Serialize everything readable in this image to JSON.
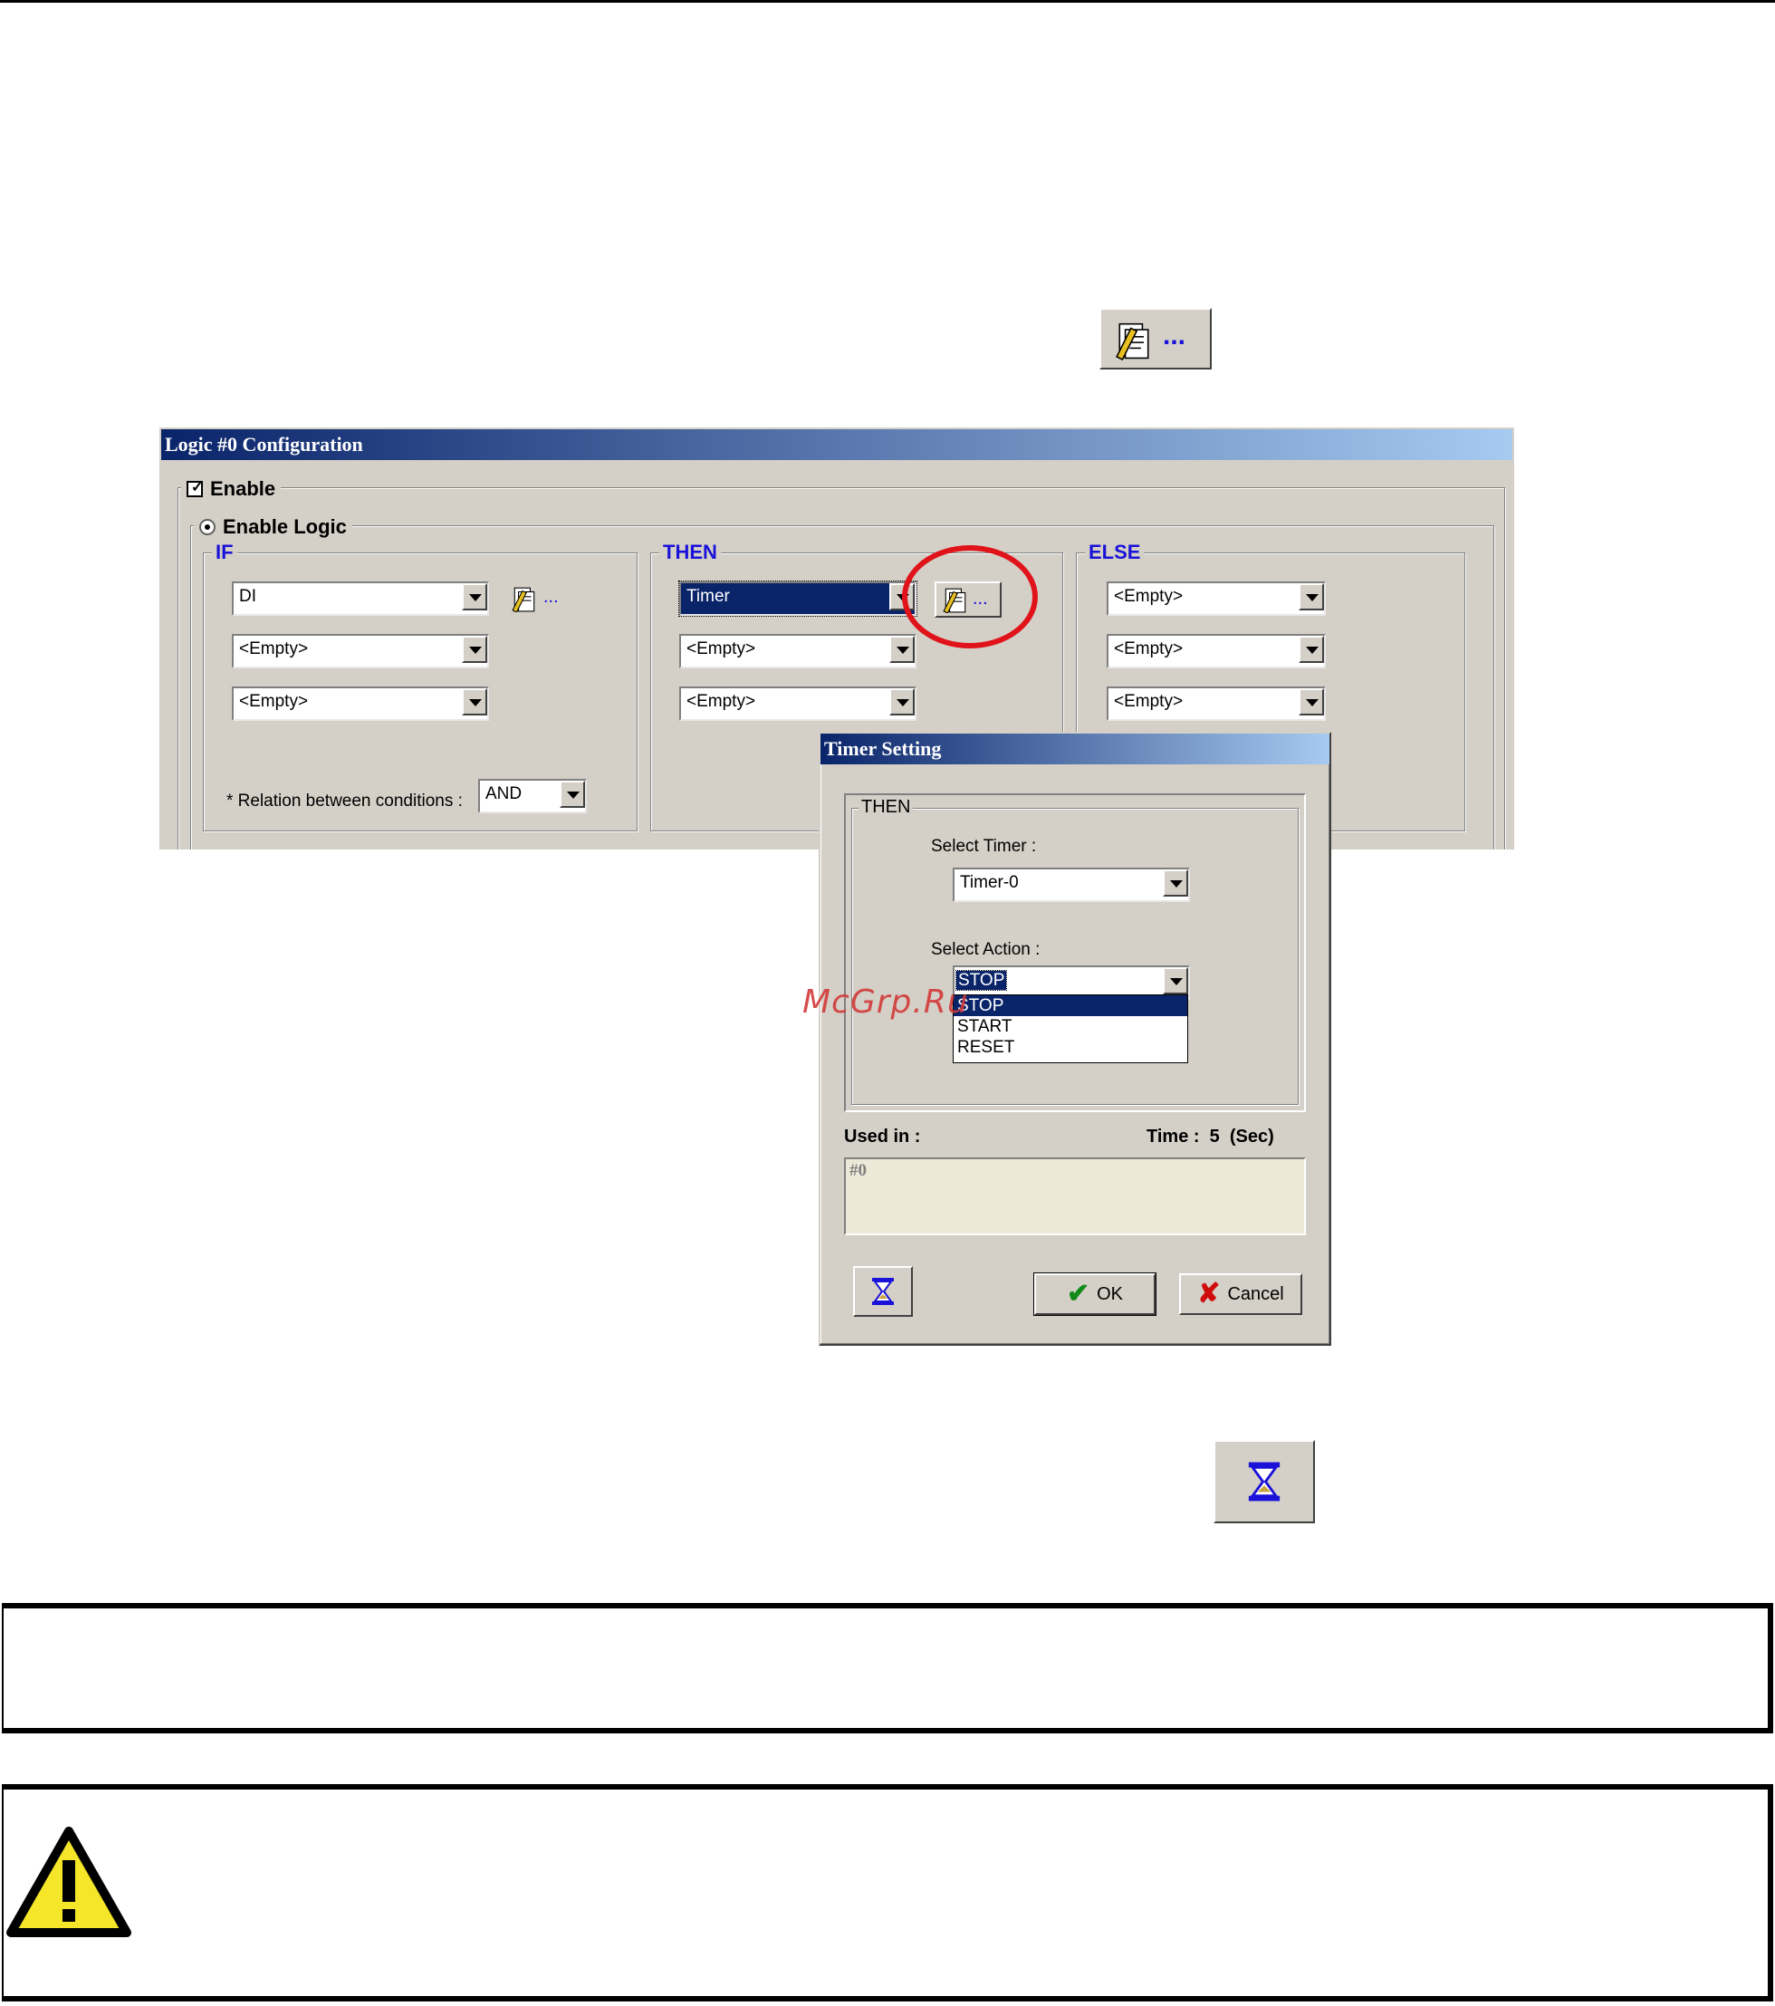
{
  "logic_window": {
    "title": "Logic #0 Configuration",
    "enable_label": "Enable",
    "enable_logic_label": "Enable Logic",
    "if_label": "IF",
    "then_label": "THEN",
    "else_label": "ELSE",
    "if_rows": [
      "DI",
      "<Empty>",
      "<Empty>"
    ],
    "then_rows": [
      "Timer",
      "<Empty>",
      "<Empty>"
    ],
    "else_rows": [
      "<Empty>",
      "<Empty>",
      "<Empty>"
    ],
    "relation_label": "* Relation between conditions :",
    "relation_value": "AND",
    "edit_button_dots": "..."
  },
  "timer_dialog": {
    "title": "Timer Setting",
    "group_label": "THEN",
    "select_timer_label": "Select Timer :",
    "select_timer_value": "Timer-0",
    "select_action_label": "Select Action :",
    "select_action_value": "STOP",
    "action_options": [
      "STOP",
      "START",
      "RESET"
    ],
    "used_in_label": "Used in :",
    "time_label": "Time :  5  (Sec)",
    "used_in_value": "#0",
    "ok_label": "OK",
    "cancel_label": "Cancel"
  },
  "top_icon_dots": "...",
  "watermark": "McGrp.Ru",
  "colors": {
    "titlebar_start": "#0a246a",
    "titlebar_end": "#a6caf0",
    "face": "#d4d0c8",
    "legend_blue": "#1a12d8",
    "highlight_circle": "#e0131a",
    "warning_yellow": "#f5e629"
  }
}
